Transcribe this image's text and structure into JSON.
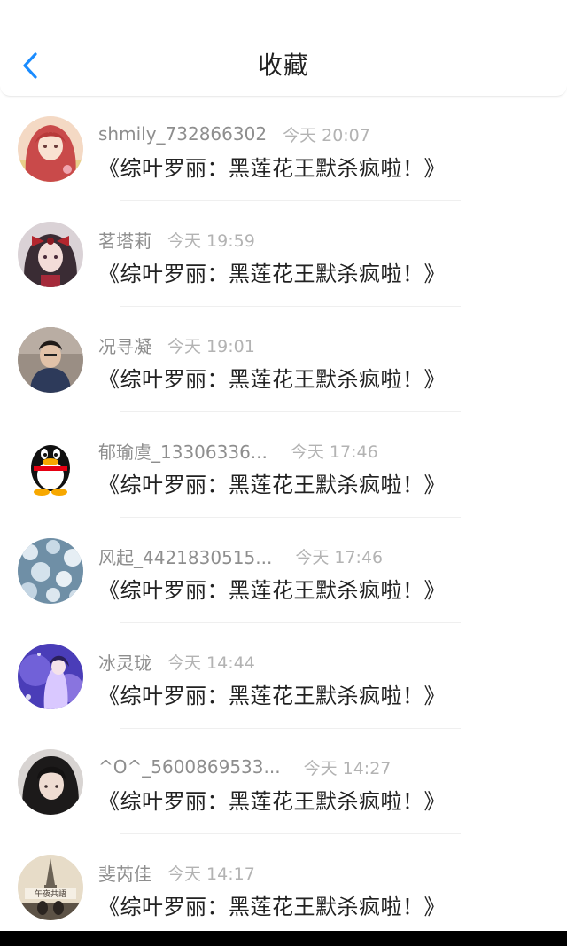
{
  "header": {
    "title": "收藏",
    "back_icon": "chevron-left-icon",
    "accent_color": "#1a8cff"
  },
  "favorites": [
    {
      "user": "shmily_732866302",
      "time": "今天 20:07",
      "title": "《综叶罗丽：黑莲花王默杀疯啦！》",
      "avatar": "anime-girl-avatar"
    },
    {
      "user": "茗塔莉",
      "time": "今天 19:59",
      "title": "《综叶罗丽：黑莲花王默杀疯啦！》",
      "avatar": "anime-girl-bow-avatar"
    },
    {
      "user": "况寻凝",
      "time": "今天 19:01",
      "title": "《综叶罗丽：黑莲花王默杀疯啦！》",
      "avatar": "photo-person-avatar"
    },
    {
      "user": "郁瑜虞_13306336...",
      "time": "今天 17:46",
      "title": "《综叶罗丽：黑莲花王默杀疯啦！》",
      "avatar": "penguin-avatar"
    },
    {
      "user": "风起_4421830515...",
      "time": "今天 17:46",
      "title": "《综叶罗丽：黑莲花王默杀疯啦！》",
      "avatar": "snow-pattern-avatar"
    },
    {
      "user": "冰灵珑",
      "time": "今天 14:44",
      "title": "《综叶罗丽：黑莲花王默杀疯啦！》",
      "avatar": "purple-fantasy-avatar"
    },
    {
      "user": "^O^_5600869533...",
      "time": "今天 14:27",
      "title": "《综叶罗丽：黑莲花王默杀疯啦！》",
      "avatar": "dark-hair-person-avatar"
    },
    {
      "user": "斐芮佳",
      "time": "今天 14:17",
      "title": "《综叶罗丽：黑莲花王默杀疯啦！》",
      "avatar": "city-photo-avatar"
    }
  ]
}
